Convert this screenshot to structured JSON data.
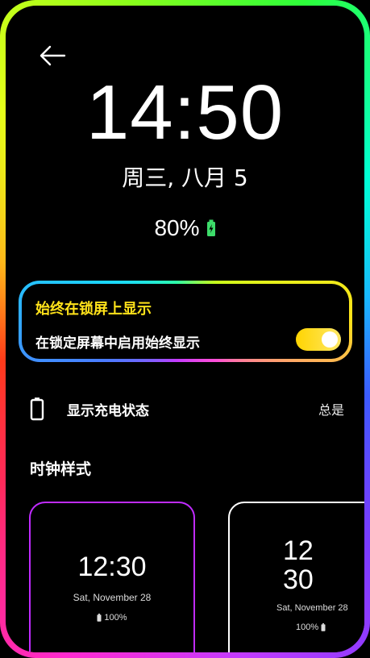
{
  "header": {
    "back_icon": "arrow-left-icon"
  },
  "preview": {
    "time": "14:50",
    "date": "周三, 八月 5",
    "battery_percent": "80%",
    "battery_icon": "battery-charging-icon",
    "battery_color": "#3ddc6a"
  },
  "aod": {
    "title": "始终在锁屏上显示",
    "subtitle": "在锁定屏幕中启用始终显示",
    "toggle_on": true,
    "title_color": "#ffe21a"
  },
  "charging": {
    "icon": "battery-outline-icon",
    "label": "显示充电状态",
    "value": "总是"
  },
  "clock_styles": {
    "title": "时钟样式",
    "cards": [
      {
        "time": "12:30",
        "date": "Sat, November 28",
        "battery": "100%",
        "selected": true
      },
      {
        "hour": "12",
        "minute": "30",
        "date": "Sat, November 28",
        "battery": "100%",
        "selected": false
      }
    ]
  }
}
